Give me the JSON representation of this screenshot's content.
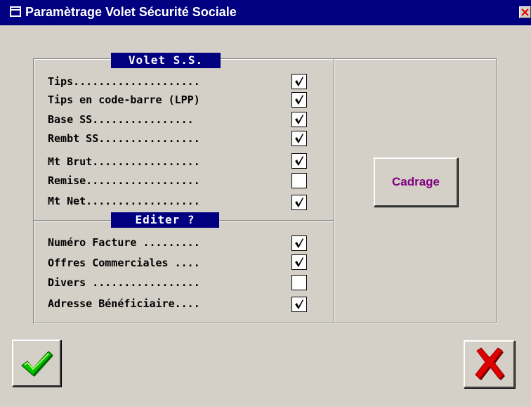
{
  "window": {
    "title": "Paramètrage Volet Sécurité Sociale",
    "icon": "window-icon",
    "close_icon": "close-icon"
  },
  "volet_ss": {
    "label": "Volet S.S.",
    "items": [
      {
        "label": "Tips....................",
        "checked": true
      },
      {
        "label": "Tips en code-barre (LPP)",
        "checked": true
      },
      {
        "label": "Base  SS................",
        "checked": true
      },
      {
        "label": "Rembt SS................",
        "checked": true
      },
      {
        "label": "Mt Brut.................",
        "checked": true
      },
      {
        "label": "Remise..................",
        "checked": false
      },
      {
        "label": "Mt Net..................",
        "checked": true
      }
    ]
  },
  "editer": {
    "label": "Editer ?",
    "items": [
      {
        "label": "Numéro Facture .........",
        "checked": true
      },
      {
        "label": "Offres Commerciales ....",
        "checked": true
      },
      {
        "label": "Divers .................",
        "checked": false
      },
      {
        "label": "Adresse Bénéficiaire....",
        "checked": true
      }
    ]
  },
  "buttons": {
    "cadrage_label": "Cadrage",
    "ok_icon": "checkmark-icon",
    "cancel_icon": "cross-icon"
  },
  "colors": {
    "title_bar": "#000080",
    "cadrage_text": "#800080",
    "ok_green": "#00a000",
    "cancel_red": "#e00000"
  }
}
